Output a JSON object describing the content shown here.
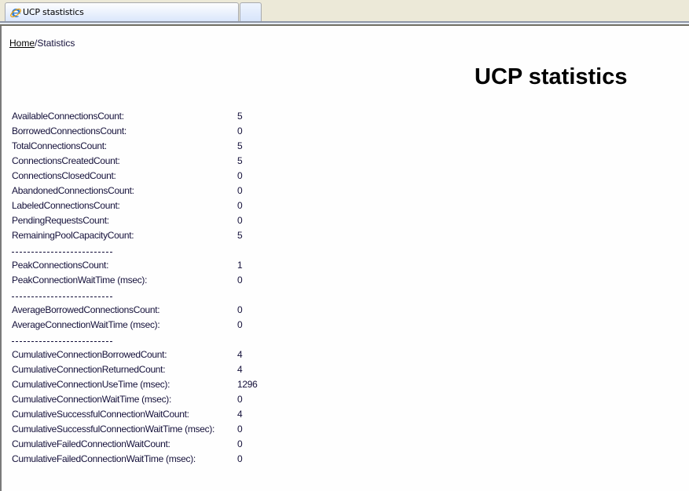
{
  "browser": {
    "tab_title": "UCP stastistics",
    "tab_icon": "internet-explorer-icon"
  },
  "page": {
    "breadcrumb": {
      "home_link": "Home",
      "separator": "/",
      "current": "Statistics"
    },
    "title": "UCP statistics"
  },
  "stats": {
    "group1": [
      {
        "label": "AvailableConnectionsCount:",
        "value": "5"
      },
      {
        "label": "BorrowedConnectionsCount:",
        "value": "0"
      },
      {
        "label": "TotalConnectionsCount:",
        "value": "5"
      },
      {
        "label": "ConnectionsCreatedCount:",
        "value": "5"
      },
      {
        "label": "ConnectionsClosedCount:",
        "value": "0"
      },
      {
        "label": "AbandonedConnectionsCount:",
        "value": "0"
      },
      {
        "label": "LabeledConnectionsCount:",
        "value": "0"
      },
      {
        "label": "PendingRequestsCount:",
        "value": "0"
      },
      {
        "label": "RemainingPoolCapacityCount:",
        "value": "5"
      }
    ],
    "group2": [
      {
        "label": "PeakConnectionsCount:",
        "value": "1"
      },
      {
        "label": "PeakConnectionWaitTime (msec):",
        "value": "0"
      }
    ],
    "group3": [
      {
        "label": "AverageBorrowedConnectionsCount:",
        "value": "0"
      },
      {
        "label": "AverageConnectionWaitTime (msec):",
        "value": "0"
      }
    ],
    "group4": [
      {
        "label": "CumulativeConnectionBorrowedCount:",
        "value": "4"
      },
      {
        "label": "CumulativeConnectionReturnedCount:",
        "value": "4"
      },
      {
        "label": "CumulativeConnectionUseTime (msec):",
        "value": "1296"
      },
      {
        "label": "CumulativeConnectionWaitTime (msec):",
        "value": "0"
      },
      {
        "label": "CumulativeSuccessfulConnectionWaitCount:",
        "value": "4"
      },
      {
        "label": "CumulativeSuccessfulConnectionWaitTime (msec):",
        "value": "0"
      },
      {
        "label": "CumulativeFailedConnectionWaitCount:",
        "value": "0"
      },
      {
        "label": "CumulativeFailedConnectionWaitTime (msec):",
        "value": "0"
      }
    ]
  }
}
